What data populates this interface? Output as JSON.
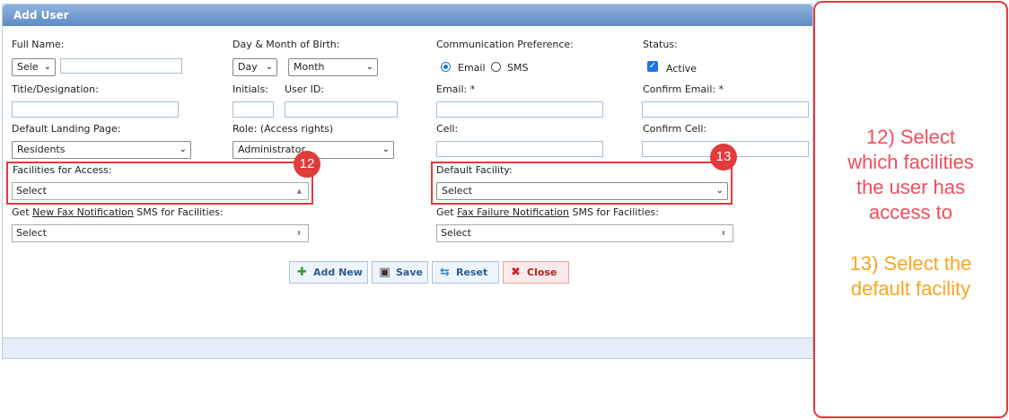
{
  "panel": {
    "title": "Add User"
  },
  "labels": {
    "full_name": "Full Name:",
    "dob": "Day & Month of Birth:",
    "comm_pref": "Communication Preference:",
    "status": "Status:",
    "title_designation": "Title/Designation:",
    "initials": "Initials:",
    "user_id": "User ID:",
    "email": "Email: *",
    "confirm_email": "Confirm Email: *",
    "landing_page": "Default Landing Page:",
    "role": "Role: (Access rights)",
    "cell": "Cell:",
    "confirm_cell": "Confirm Cell:",
    "facilities_access": "Facilities for Access:",
    "default_facility": "Default Facility:",
    "fax_notif_prefix": "Get ",
    "fax_notif_link": "New Fax Notification",
    "fax_notif_suffix": " SMS for Facilities:",
    "fax_fail_prefix": "Get ",
    "fax_fail_link": "Fax Failure Notification",
    "fax_fail_suffix": " SMS for Facilities:"
  },
  "fields": {
    "salutation": "Sele",
    "day": "Day",
    "month": "Month",
    "landing_page": "Residents",
    "role": "Administrator",
    "facilities_access": "Select",
    "default_facility": "Select",
    "fax_notif": "Select",
    "fax_fail": "Select"
  },
  "comm": {
    "email": "Email",
    "sms": "SMS",
    "selected": "Email"
  },
  "status": {
    "active": "Active",
    "checked": true
  },
  "buttons": {
    "add_new": "Add New",
    "save": "Save",
    "reset": "Reset",
    "close": "Close"
  },
  "badges": {
    "b12": "12",
    "b13": "13"
  },
  "notes": {
    "n12": [
      "12) Select",
      "which facilities",
      "the user has",
      "access to"
    ],
    "n13": [
      "13) Select the",
      "default facility"
    ]
  },
  "colors": {
    "header": "#6a95c9",
    "highlight": "#e23b3b",
    "note12": "#f24d5a",
    "note13": "#f6a623"
  }
}
